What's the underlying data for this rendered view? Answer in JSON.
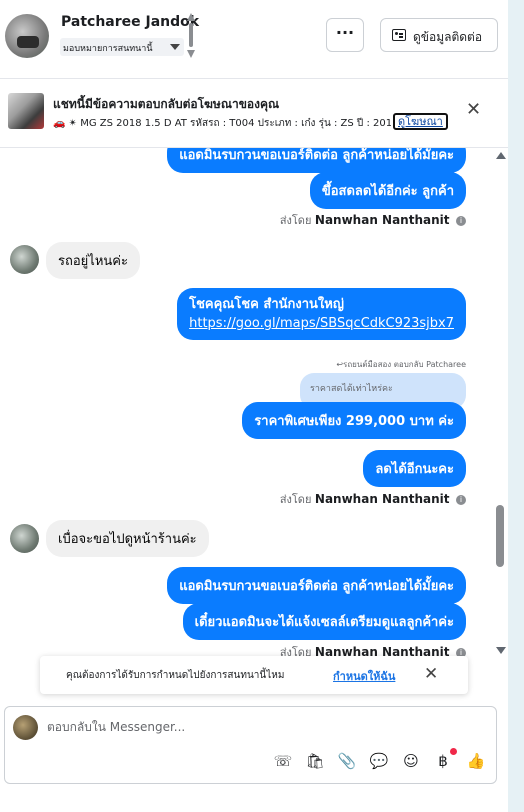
{
  "header": {
    "contact_name": "Patcharee Jandok",
    "assign_label": "มอบหมายการสนทนานี้",
    "more_label": "···",
    "contact_info_label": "ดูข้อมูลติดต่อ"
  },
  "ad_banner": {
    "title": "แชทนี้มีข้อความตอบกลับต่อโฆษณาของคุณ",
    "subtitle": "🚗 ✴ MG ZS 2018 1.5 D AT รหัสรถ : T004 ประเภท : เก๋ง รุ่น : ZS ปี : 201...",
    "link_label": "ดูโฆษณา",
    "close_label": "✕"
  },
  "messages": [
    {
      "type": "out",
      "text": "แอดมินรบกวนขอเบอร์ติดต่อ ลูกค้าหน่อยได้มั้ยคะ"
    },
    {
      "type": "out",
      "text": "ขึ้อสดลดได้อีกค่ะ  ลูกค้า"
    },
    {
      "type": "sent_by",
      "prefix": "ส่งโดย",
      "name": "Nanwhan Nanthanit"
    },
    {
      "type": "in",
      "text": "รถอยู่ไหนค่ะ"
    },
    {
      "type": "out",
      "text": "โชคคุณโชค สำนักงานใหญ่",
      "link": "https://goo.gl/maps/SBSqcCdkC923sjbx7"
    },
    {
      "type": "reply_meta",
      "text": "↩รถยนต์มือสอง ตอบกลับ Patcharee"
    },
    {
      "type": "quoted",
      "text": "ราคาสดได้เท่าไหร่คะ"
    },
    {
      "type": "out",
      "text": "ราคาพิเศษเพียง 299,000 บาท ค่ะ"
    },
    {
      "type": "out",
      "text": "ลดได้อีกนะคะ"
    },
    {
      "type": "sent_by",
      "prefix": "ส่งโดย",
      "name": "Nanwhan Nanthanit"
    },
    {
      "type": "in",
      "text": "เบื่อจะขอไปดูหน้าร้านค่ะ"
    },
    {
      "type": "out",
      "text": "แอดมินรบกวนขอเบอร์ติดต่อ ลูกค้าหน่อยได้มั้ยคะ"
    },
    {
      "type": "out",
      "text": "เดี๋ยวแอดมินจะได้แจ้งเซลล์เตรียมดูแลลูกค้าค่ะ"
    },
    {
      "type": "sent_by",
      "prefix": "ส่งโดย",
      "name": "Nanwhan Nanthanit"
    }
  ],
  "info_icon": "i",
  "toast": {
    "text": "คุณต้องการได้รับการกำหนดไปยังการสนทนานี้ไหม",
    "link_label": "กำหนดให้ฉัน",
    "close_label": "✕"
  },
  "composer": {
    "placeholder": "ตอบกลับใน Messenger...",
    "tools": [
      {
        "name": "phone-plus-icon",
        "glyph": "☏"
      },
      {
        "name": "shopping-bag-icon",
        "glyph": "🛍"
      },
      {
        "name": "attachment-icon",
        "glyph": "📎"
      },
      {
        "name": "saved-reply-icon",
        "glyph": "💬"
      },
      {
        "name": "emoji-icon",
        "glyph": "☺"
      },
      {
        "name": "payment-icon",
        "glyph": "฿"
      },
      {
        "name": "thumbs-up-icon",
        "glyph": "👍"
      }
    ]
  },
  "colors": {
    "outgoing_bubble": "#0a7cff",
    "incoming_bubble": "#f0f0f0",
    "link": "#1b74e4",
    "badge": "#f02849"
  }
}
